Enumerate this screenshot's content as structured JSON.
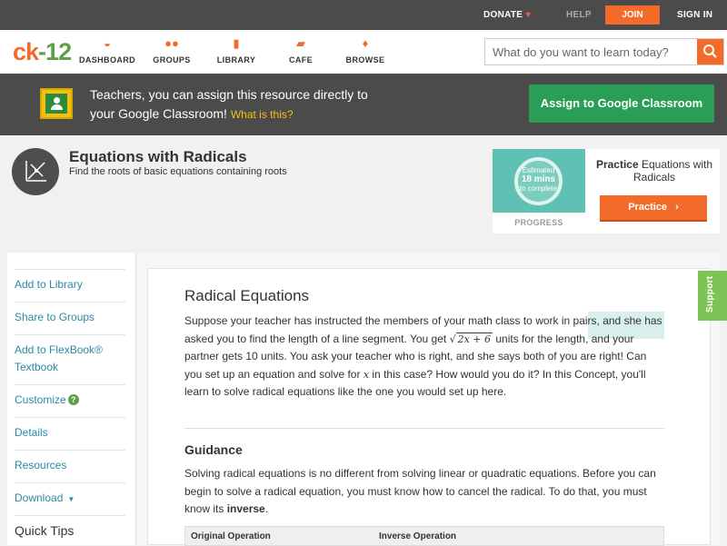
{
  "topbar": {
    "donate": "DONATE",
    "help": "HELP",
    "join": "JOIN",
    "signin": "SIGN IN"
  },
  "nav": {
    "logo_ck": "ck",
    "logo_dash": "-",
    "logo_12": "12",
    "items": [
      {
        "label": "DASHBOARD",
        "icon": "gauge-icon"
      },
      {
        "label": "GROUPS",
        "icon": "group-icon"
      },
      {
        "label": "LIBRARY",
        "icon": "library-icon"
      },
      {
        "label": "CAFE",
        "icon": "chat-icon"
      },
      {
        "label": "BROWSE",
        "icon": "lightbulb-icon"
      }
    ],
    "search_placeholder": "What do you want to learn today?"
  },
  "banner": {
    "line1": "Teachers, you can assign this resource directly to",
    "line2": "your Google Classroom!",
    "what": "What is this?",
    "assign_button": "Assign to Google Classroom"
  },
  "concept": {
    "title": "Equations with Radicals",
    "subtitle": "Find the roots of basic equations containing roots"
  },
  "practice": {
    "estimated": "Estimated",
    "mins": "18 mins",
    "to_complete": "to complete",
    "progress_label": "PROGRESS",
    "title_bold": "Practice",
    "title_rest": "Equations with Radicals",
    "button": "Practice"
  },
  "sidebar": {
    "items": [
      "Add to Library",
      "Share to Groups",
      "Add to FlexBook® Textbook",
      "Customize",
      "Details",
      "Resources",
      "Download"
    ],
    "quick_tips": "Quick Tips"
  },
  "content": {
    "heading": "Radical Equations",
    "intro_a": "Suppose your teacher has instructed the members of your math class to work in pairs, and she has asked you to find the length of a line segment. You get",
    "sqrt_expr": "2x + 6",
    "intro_b": "units for the length, and your partner gets 10 units. You ask your teacher who is right, and she says both of you are right! Can you set up an equation and solve for",
    "var_x": "x",
    "intro_c": "in this case? How would you do it? In this Concept, you'll learn to solve radical equations like the one you would set up here.",
    "guidance_heading": "Guidance",
    "guidance_a": "Solving radical equations is no different from solving linear or quadratic equations. Before you can begin to solve a radical equation, you must know how to cancel the radical. To do that, you must know its",
    "guidance_bold": "inverse",
    "guidance_end": ".",
    "table_headers": [
      "Original Operation",
      "Inverse Operation"
    ]
  },
  "support_tab": "Support"
}
